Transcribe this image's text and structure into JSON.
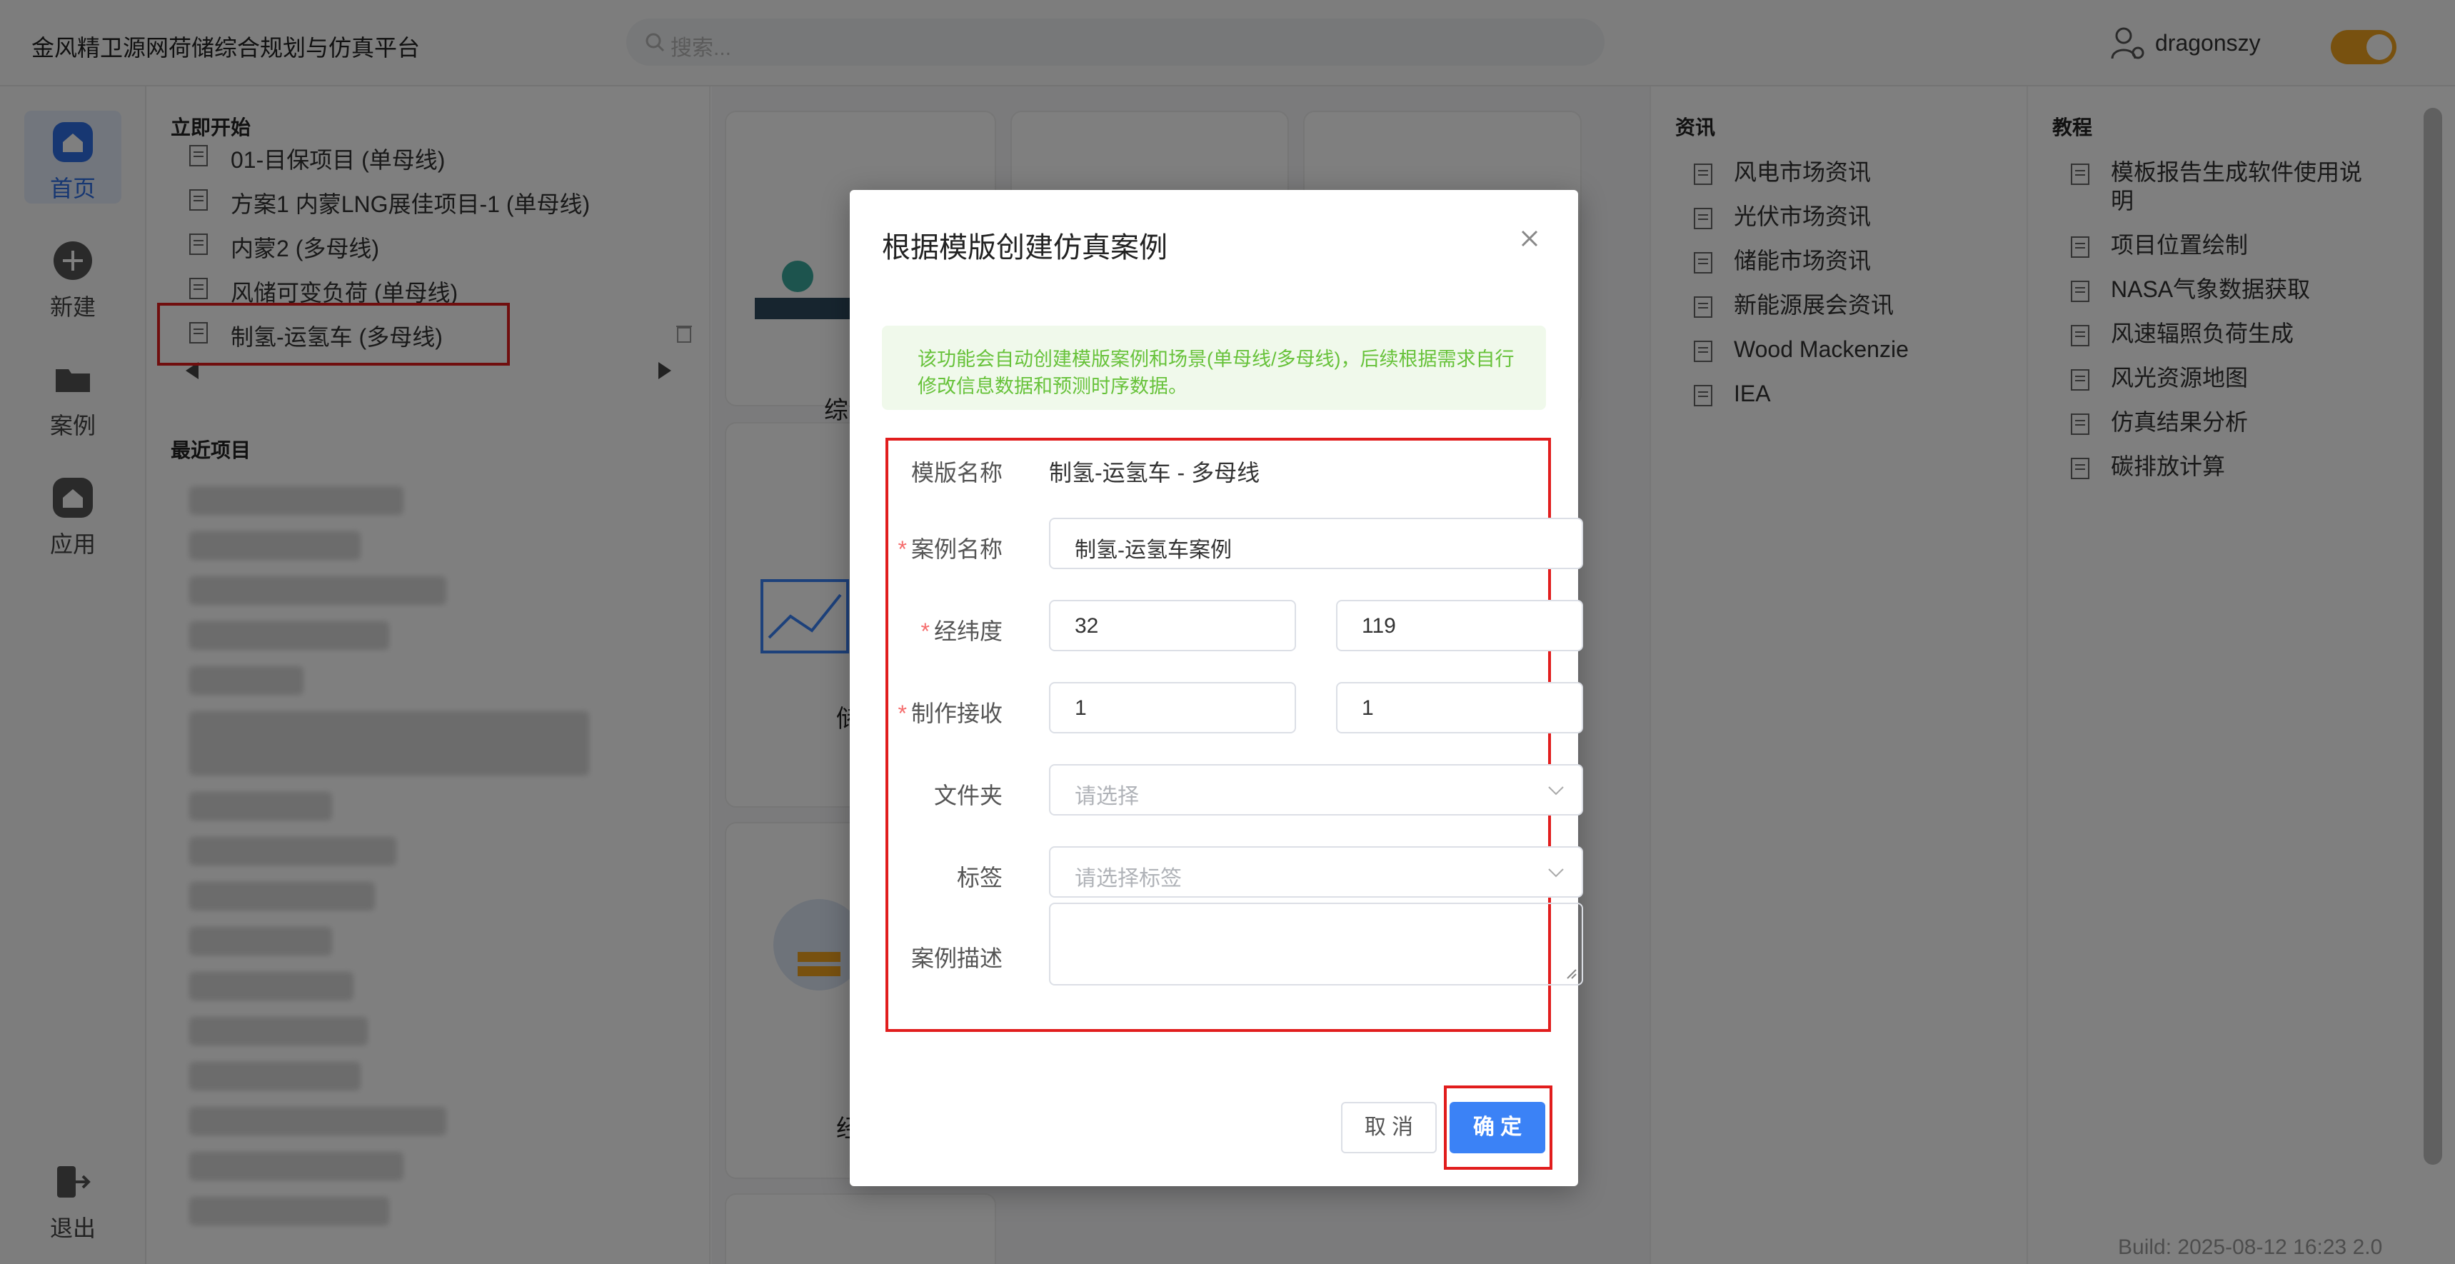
{
  "app": {
    "title": "金风精卫源网荷储综合规划与仿真平台"
  },
  "search": {
    "placeholder": "搜索..."
  },
  "user": {
    "name": "dragonszy"
  },
  "nav": {
    "home": "首页",
    "new": "新建",
    "cases": "案例",
    "apps": "应用",
    "logout": "退出"
  },
  "start": {
    "title": "立即开始",
    "items": [
      "01-目保项目 (单母线)",
      "方案1 内蒙LNG展佳项目-1 (单母线)",
      "内蒙2 (多母线)",
      "风储可变负荷 (单母线)",
      "制氢-运氢车 (多母线)"
    ]
  },
  "recent": {
    "title": "最近项目"
  },
  "cards": {
    "c1": "综合能",
    "c2": "储能",
    "c3": "经济"
  },
  "news": {
    "title": "资讯",
    "items": [
      "风电市场资讯",
      "光伏市场资讯",
      "储能市场资讯",
      "新能源展会资讯",
      "Wood Mackenzie",
      "IEA"
    ]
  },
  "tutorial": {
    "title": "教程",
    "items": [
      "模板报告生成软件使用说明",
      "项目位置绘制",
      "NASA气象数据获取",
      "风速辐照负荷生成",
      "风光资源地图",
      "仿真结果分析",
      "碳排放计算"
    ]
  },
  "build": "Build: 2025-08-12 16:23 2.0",
  "modal": {
    "title": "根据模版创建仿真案例",
    "alert": "该功能会自动创建模版案例和场景(单母线/多母线)，后续根据需求自行修改信息数据和预测时序数据。",
    "template_label": "模版名称",
    "template_value": "制氢-运氢车 - 多母线",
    "case_name_label": "案例名称",
    "case_name_value": "制氢-运氢车案例",
    "latlon_label": "经纬度",
    "lat_value": "32",
    "lon_value": "119",
    "recv_label": "制作接收",
    "recv_a": "1",
    "recv_b": "1",
    "folder_label": "文件夹",
    "folder_placeholder": "请选择",
    "tags_label": "标签",
    "tags_placeholder": "请选择标签",
    "desc_label": "案例描述",
    "cancel": "取 消",
    "ok": "确 定",
    "required_mark": "*"
  }
}
